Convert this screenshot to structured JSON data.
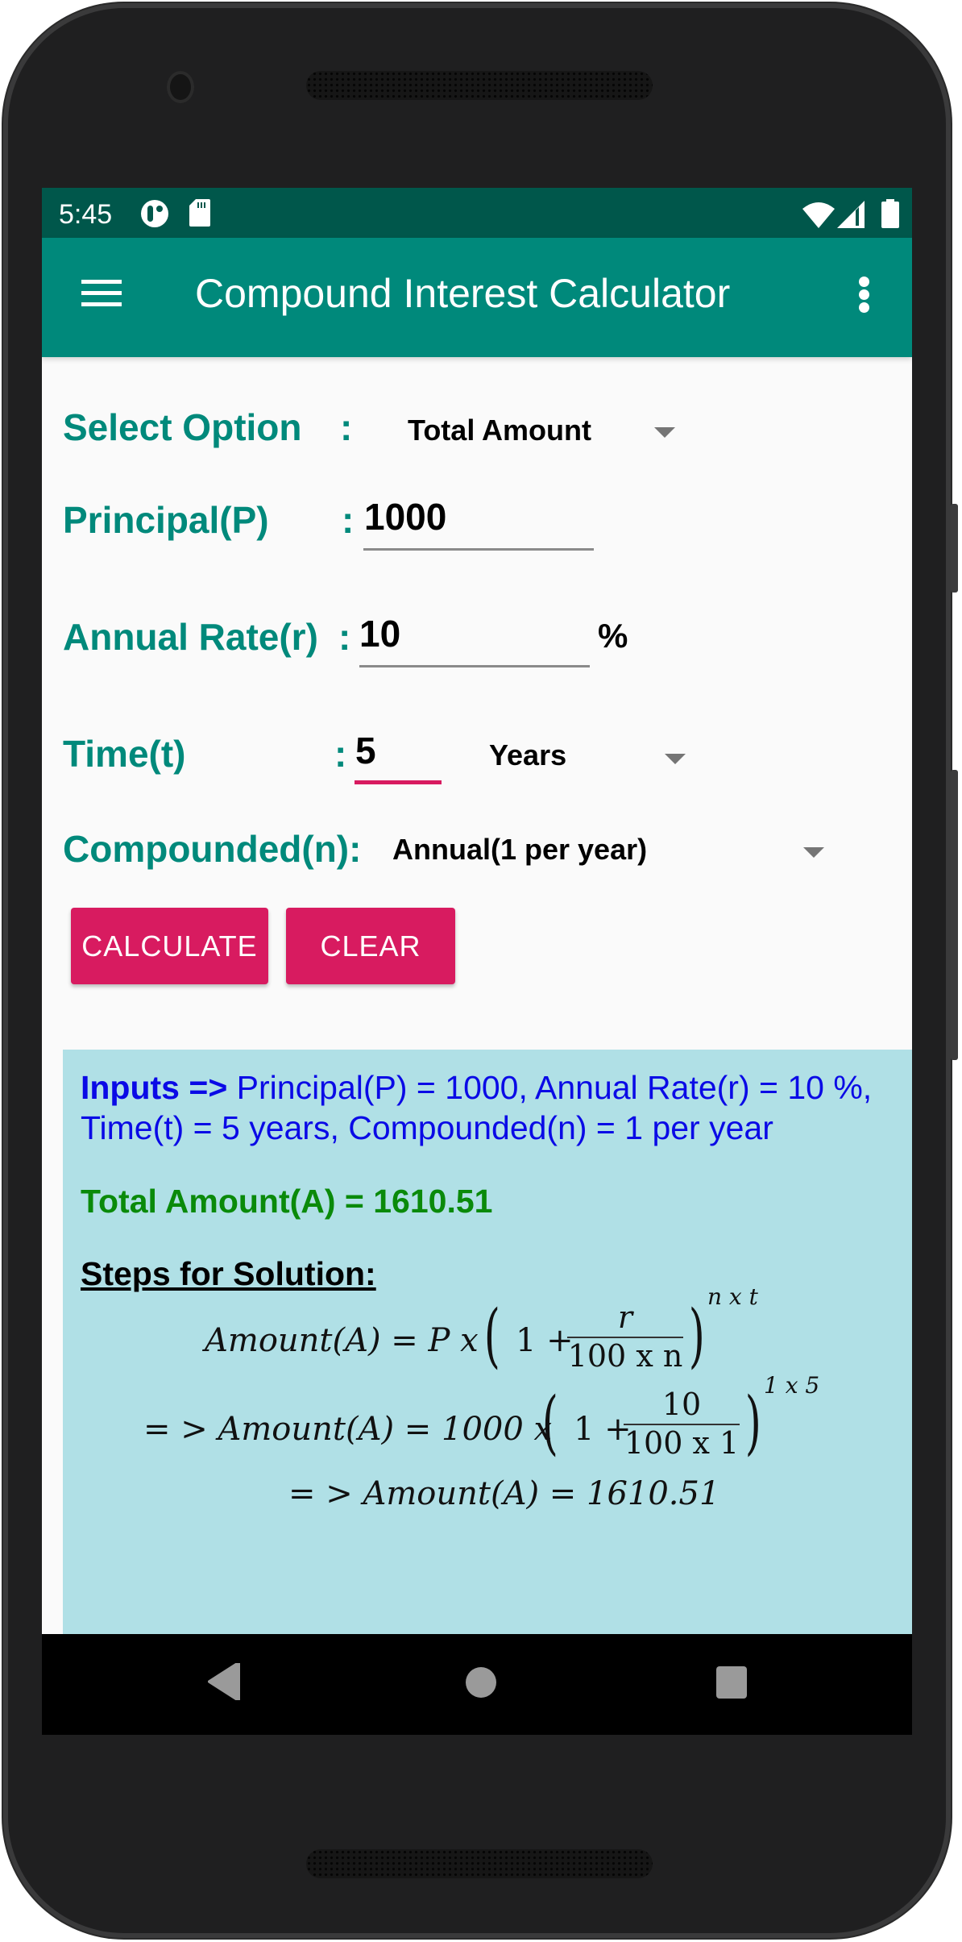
{
  "status_bar": {
    "time": "5:45",
    "icons": [
      "data-saver-icon",
      "sd-card-icon",
      "wifi-icon",
      "signal-icon",
      "battery-icon"
    ]
  },
  "app_bar": {
    "title": "Compound Interest Calculator",
    "menu_icon": "hamburger-menu-icon",
    "overflow_icon": "more-vert-icon"
  },
  "form": {
    "select_option": {
      "label": "Select Option",
      "colon": ":",
      "value": "Total Amount"
    },
    "principal": {
      "label": "Principal(P)",
      "colon": ":",
      "value": "1000"
    },
    "rate": {
      "label": "Annual Rate(r)",
      "colon": ":",
      "value": "10",
      "suffix": "%"
    },
    "time": {
      "label": "Time(t)",
      "colon": ":",
      "value": "5",
      "unit": "Years"
    },
    "compounded": {
      "label": "Compounded(n):",
      "value": "Annual(1 per year)"
    },
    "calculate_label": "CALCULATE",
    "clear_label": "CLEAR"
  },
  "result": {
    "inputs_prefix": "Inputs =>",
    "inputs_text": " Principal(P) = 1000, Annual Rate(r) = 10 %, Time(t) = 5 years, Compounded(n) = 1 per year",
    "total": "Total Amount(A) = 1610.51",
    "steps_title": "Steps for Solution:",
    "formula": {
      "lhs": "Amount(A) = P x",
      "one_plus": "1 +",
      "numerator": "r",
      "denominator": "100 x n",
      "exponent": "n x t"
    },
    "substituted": {
      "lhs": "= > Amount(A) = 1000 x",
      "one_plus": "1 +",
      "numerator": "10",
      "denominator": "100 x 1",
      "exponent": "1 x 5"
    },
    "final": "= > Amount(A) = 1610.51"
  },
  "colors": {
    "primary": "#00897b",
    "primary_dark": "#00574b",
    "accent": "#d81b60",
    "result_bg": "#b0e0e6",
    "inputs_text": "#0a0ae6",
    "total_text": "#0a8a0a"
  },
  "nav_bar": {
    "back": "back-icon",
    "home": "home-icon",
    "recents": "recents-icon"
  }
}
